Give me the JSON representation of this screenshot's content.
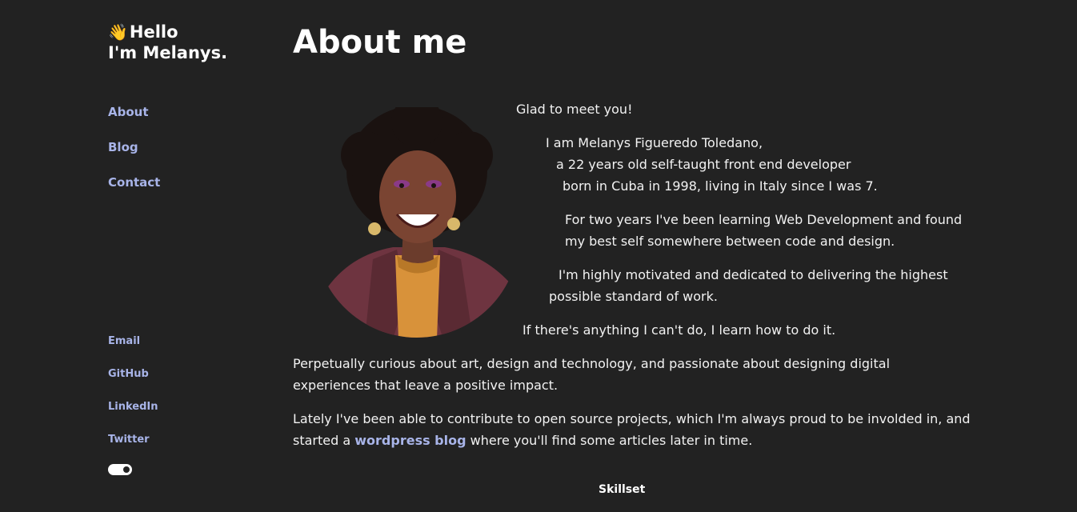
{
  "sidebar": {
    "greeting_emoji": "👋",
    "greeting_line1": "Hello",
    "greeting_line2": "I'm Melanys.",
    "nav": [
      "About",
      "Blog",
      "Contact"
    ],
    "social": [
      "Email",
      "GitHub",
      "LinkedIn",
      "Twitter"
    ],
    "theme_toggle_on": true
  },
  "main": {
    "title": "About me",
    "intro": {
      "greeting": "Glad to meet you!",
      "lines": [
        "I am Melanys Figueredo Toledano,",
        "a 22 years old self-taught front end developer",
        "born in Cuba in 1998, living in Italy since I was 7.",
        "For two years I've been learning Web Development and found",
        "my best self somewhere between code and design.",
        "I'm highly motivated and dedicated to delivering the highest",
        "possible standard of work.",
        "If there's anything I can't do, I learn how to do it."
      ]
    },
    "paragraph1": [
      "Perpetually curious about art, design and technology, and passionate about designing digital",
      "experiences that leave a positive impact."
    ],
    "paragraph2": {
      "line1": "Lately I've been able to contribute to open source projects, which I'm always proud to be involded in, and",
      "line2_before": "started a ",
      "link": "wordpress blog",
      "line2_after": " where you'll find some articles later in time."
    },
    "skillset_heading": "Skillset"
  },
  "colors": {
    "background": "#222222",
    "link": "#a8b4e8",
    "text": "#f2f2f2"
  }
}
